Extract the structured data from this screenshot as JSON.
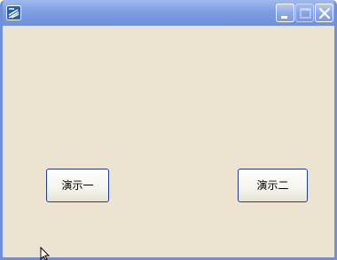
{
  "window": {
    "title": "",
    "icon": "app-window-icon",
    "controls": {
      "minimize_icon": "minimize-icon",
      "maximize_icon": "maximize-icon",
      "close_icon": "close-icon"
    },
    "colors": {
      "titlebar": "#7f9de3",
      "client_background": "#ece4d0",
      "button_border": "#1c3f95"
    }
  },
  "buttons": {
    "demo1_label": "演示一",
    "demo2_label": "演示二"
  }
}
